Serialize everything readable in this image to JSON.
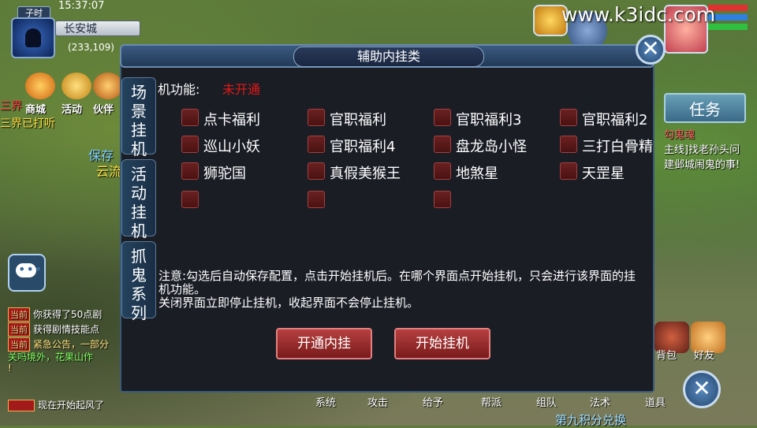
{
  "watermark": "www.k3idc.com",
  "hud": {
    "time_period": "子时",
    "clock": "15:37:07",
    "city": "长安城",
    "coords": "(233,109)"
  },
  "top_icons": [
    {
      "label": "商城",
      "icon": "shop-icon"
    },
    {
      "label": "活动",
      "icon": "activity-icon"
    },
    {
      "label": "伙伴",
      "icon": "partner-icon"
    }
  ],
  "left_texts": {
    "line1": "三界",
    "line2": "三界已打听",
    "save": "保存",
    "cloud": "云流"
  },
  "chat": [
    {
      "tag": "当前",
      "text": "你获得了50点剧",
      "highlight": "50点"
    },
    {
      "tag": "当前",
      "text": "获得剧情技能点"
    },
    {
      "tag": "当前",
      "text": "紧急公告，一部分"
    },
    {
      "tag": "",
      "text": "关吗境外，花果山作"
    },
    {
      "tag": "",
      "text": "!"
    },
    {
      "tag": "",
      "text": "现在开始起风了"
    }
  ],
  "right_panel": {
    "task_button": "任务",
    "quest_title": "勾鬼魂",
    "quest_line1": "主线]找老孙头问",
    "quest_line2": "建邺城闹鬼的事!",
    "icons": [
      {
        "label": "背包",
        "icon": "bag-icon"
      },
      {
        "label": "好友",
        "icon": "friends-icon"
      },
      {
        "label": "道具",
        "icon": "item-icon"
      }
    ]
  },
  "bottom_menu": [
    "系统",
    "攻击",
    "给予",
    "帮派",
    "组队",
    "法术"
  ],
  "bottom_banner": "第九积分兑换",
  "dialog": {
    "title": "辅助内挂类",
    "side_tabs": [
      {
        "label": "场景挂机",
        "lines": [
          "场",
          "景",
          "挂",
          "机"
        ]
      },
      {
        "label": "活动挂机",
        "lines": [
          "活",
          "动",
          "挂",
          "机"
        ]
      },
      {
        "label": "抓鬼系列",
        "lines": [
          "抓",
          "鬼",
          "系",
          "列"
        ]
      }
    ],
    "function_label": "机功能:",
    "function_status": "未开通",
    "options": [
      [
        "点卡福利",
        "官职福利",
        "官职福利3",
        "官职福利2"
      ],
      [
        "巡山小妖",
        "官职福利4",
        "盘龙岛小怪",
        "三打白骨精"
      ],
      [
        "狮驼国",
        "真假美猴王",
        "地煞星",
        "天罡星"
      ],
      [
        "",
        "",
        ""
      ]
    ],
    "note": "注意:勾选后自动保存配置，点击开始挂机后。在哪个界面点开始挂机，只会进行该界面的挂机功能。",
    "note_line3": "关闭界面立即停止挂机，收起界面不会停止挂机。",
    "buttons": {
      "activate": "开通内挂",
      "start": "开始挂机"
    }
  },
  "colors": {
    "accent_red": "#e01818",
    "dialog_bg": "#1b1d25",
    "checkbox": "#5a1818",
    "button_red": "#9a2a2a"
  }
}
